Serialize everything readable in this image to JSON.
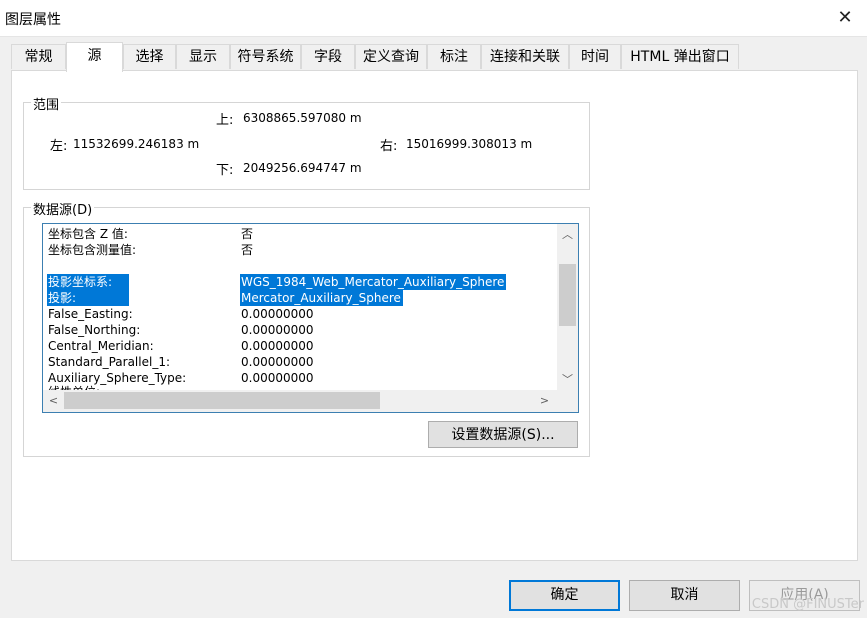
{
  "window": {
    "title": "图层属性"
  },
  "tabs": [
    {
      "label": "常规"
    },
    {
      "label": "源"
    },
    {
      "label": "选择"
    },
    {
      "label": "显示"
    },
    {
      "label": "符号系统"
    },
    {
      "label": "字段"
    },
    {
      "label": "定义查询"
    },
    {
      "label": "标注"
    },
    {
      "label": "连接和关联"
    },
    {
      "label": "时间"
    },
    {
      "label": "HTML 弹出窗口"
    }
  ],
  "active_tab": "源",
  "extent": {
    "title": "范围",
    "top_label": "上:",
    "top_value": "6308865.597080 m",
    "left_label": "左:",
    "left_value": "11532699.246183 m",
    "right_label": "右:",
    "right_value": "15016999.308013 m",
    "bottom_label": "下:",
    "bottom_value": "2049256.694747 m"
  },
  "datasource": {
    "title": "数据源(D)",
    "rows": [
      {
        "key": "坐标包含 Z 值:",
        "value": "否"
      },
      {
        "key": "坐标包含测量值:",
        "value": "否"
      },
      {
        "key": "",
        "value": ""
      },
      {
        "key": "投影坐标系:",
        "value": "WGS_1984_Web_Mercator_Auxiliary_Sphere"
      },
      {
        "key": "投影:",
        "value": "Mercator_Auxiliary_Sphere"
      },
      {
        "key": "False_Easting:",
        "value": "0.00000000"
      },
      {
        "key": "False_Northing:",
        "value": "0.00000000"
      },
      {
        "key": "Central_Meridian:",
        "value": "0.00000000"
      },
      {
        "key": "Standard_Parallel_1:",
        "value": "0.00000000"
      },
      {
        "key": "Auxiliary_Sphere_Type:",
        "value": "0.00000000"
      },
      {
        "key": "线性单位:",
        "value": ""
      }
    ],
    "set_button": "设置数据源(S)..."
  },
  "footer": {
    "ok": "确定",
    "cancel": "取消",
    "apply": "应用(A)"
  },
  "watermark": "CSDN @FINUSTer",
  "colors": {
    "selection": "#0078d7",
    "default_button_border": "#0078d7"
  }
}
